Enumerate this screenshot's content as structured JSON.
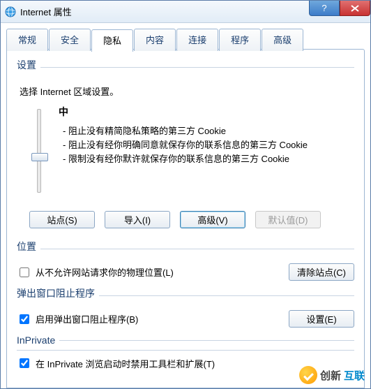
{
  "window": {
    "title": "Internet 属性"
  },
  "tabs": {
    "general": "常规",
    "security": "安全",
    "privacy": "隐私",
    "content": "内容",
    "connections": "连接",
    "programs": "程序",
    "advanced": "高级"
  },
  "settings": {
    "heading": "设置",
    "select_zone": "选择 Internet 区域设置。",
    "level": "中",
    "bullet1": "- 阻止没有精简隐私策略的第三方 Cookie",
    "bullet2": "- 阻止没有经你明确同意就保存你的联系信息的第三方 Cookie",
    "bullet3": "- 限制没有经你默许就保存你的联系信息的第三方 Cookie",
    "buttons": {
      "sites": "站点(S)",
      "import": "导入(I)",
      "advanced": "高级(V)",
      "default": "默认值(D)"
    }
  },
  "location": {
    "heading": "位置",
    "never_allow": "从不允许网站请求你的物理位置(L)",
    "never_allow_checked": false,
    "clear_sites": "清除站点(C)"
  },
  "popup": {
    "heading": "弹出窗口阻止程序",
    "enable": "启用弹出窗口阻止程序(B)",
    "enable_checked": true,
    "settings": "设置(E)"
  },
  "inprivate": {
    "heading": "InPrivate",
    "disable_toolbars": "在 InPrivate 浏览启动时禁用工具栏和扩展(T)",
    "disable_toolbars_checked": true
  },
  "watermark": {
    "brand1": "创新",
    "brand2": "互联"
  }
}
